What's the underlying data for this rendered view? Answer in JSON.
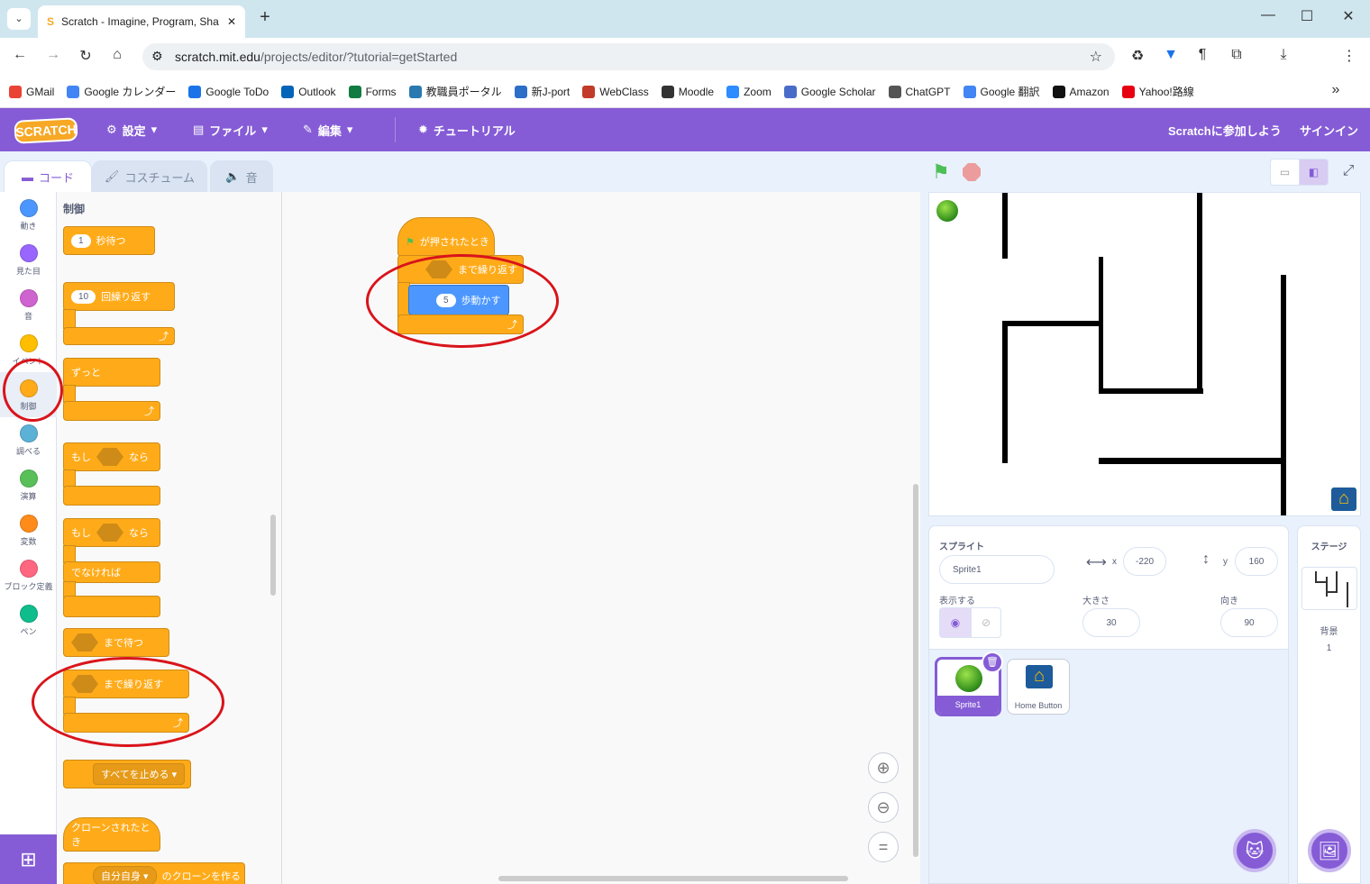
{
  "browser": {
    "tab_title": "Scratch - Imagine, Program, Sha",
    "url_host": "scratch.mit.edu",
    "url_path": "/projects/editor/?tutorial=getStarted",
    "bookmarks": [
      "GMail",
      "Google カレンダー",
      "Google ToDo",
      "Outlook",
      "Forms",
      "教職員ポータル",
      "新J-port",
      "WebClass",
      "Moodle",
      "Zoom",
      "Google Scholar",
      "ChatGPT",
      "Google 翻訳",
      "Amazon",
      "Yahoo!路線"
    ],
    "bookmark_colors": [
      "#ea4335",
      "#4285f4",
      "#1a73e8",
      "#0364b8",
      "#107c41",
      "#2a7ab0",
      "#2c6ec8",
      "#c23a2a",
      "#333333",
      "#2d8cff",
      "#4a6cc9",
      "#555555",
      "#4285f4",
      "#111111",
      "#e60012"
    ]
  },
  "menu": {
    "logo": "SCRATCH",
    "settings": "設定",
    "file": "ファイル",
    "edit": "編集",
    "tutorial": "チュートリアル",
    "join": "Scratchに参加しよう",
    "signin": "サインイン"
  },
  "editor_tabs": {
    "code": "コード",
    "costumes": "コスチューム",
    "sounds": "音"
  },
  "categories": [
    {
      "label": "動き",
      "color": "#4c97ff"
    },
    {
      "label": "見た目",
      "color": "#9966ff"
    },
    {
      "label": "音",
      "color": "#cf63cf"
    },
    {
      "label": "イベント",
      "color": "#ffbf00"
    },
    {
      "label": "制御",
      "color": "#ffab19"
    },
    {
      "label": "調べる",
      "color": "#5cb1d6"
    },
    {
      "label": "演算",
      "color": "#59c059"
    },
    {
      "label": "変数",
      "color": "#ff8c1a"
    },
    {
      "label": "ブロック定義",
      "color": "#ff6680"
    },
    {
      "label": "ペン",
      "color": "#0fbd8c"
    }
  ],
  "palette": {
    "heading": "制御",
    "wait": {
      "value": "1",
      "label": "秒待つ"
    },
    "repeat": {
      "value": "10",
      "label": "回繰り返す"
    },
    "forever": "ずっと",
    "if_then": {
      "if": "もし",
      "then": "なら"
    },
    "if_else": {
      "if": "もし",
      "then": "なら",
      "else": "でなければ"
    },
    "wait_until": "まで待つ",
    "repeat_until": "まで繰り返す",
    "stop": "すべてを止める",
    "clone_start": "クローンされたとき",
    "create_clone": {
      "target": "自分自身",
      "label": "のクローンを作る"
    }
  },
  "script": {
    "hat": "が押されたとき",
    "repeat_until": "まで繰り返す",
    "move_value": "5",
    "move_label": "歩動かす"
  },
  "sprite_info": {
    "heading": "スプライト",
    "name": "Sprite1",
    "x_label": "x",
    "x": "-220",
    "y_label": "y",
    "y": "160",
    "show_label": "表示する",
    "size_label": "大きさ",
    "size": "30",
    "direction_label": "向き",
    "direction": "90"
  },
  "sprites": [
    {
      "name": "Sprite1",
      "selected": true
    },
    {
      "name": "Home Button",
      "selected": false
    }
  ],
  "stage_panel": {
    "heading": "ステージ",
    "backdrop_label": "背景",
    "backdrop_count": "1"
  }
}
